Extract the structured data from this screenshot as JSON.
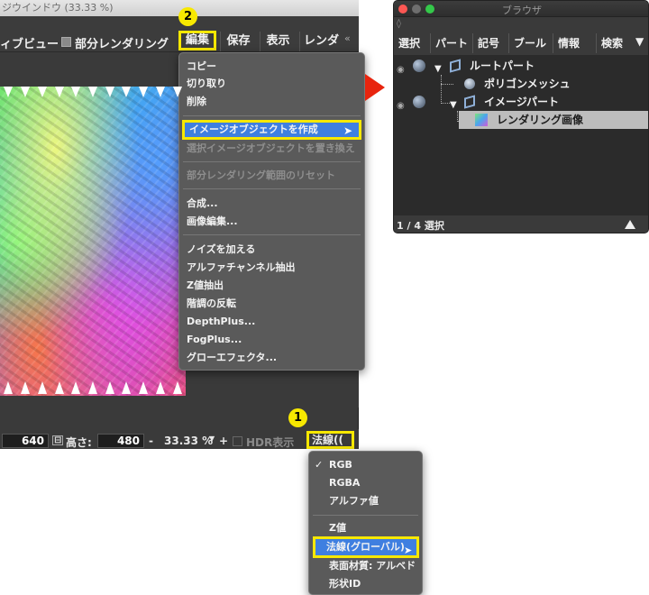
{
  "render_window": {
    "title": "ジウインドウ (33.33 %)",
    "toolbar": {
      "preview_label": "ィブビュー",
      "partial_render_label": "部分レンダリング",
      "tabs": [
        "編集",
        "保存",
        "表示",
        "レンダ"
      ],
      "overflow_icon": "double-chevron-icon"
    },
    "status": {
      "width_value": "640",
      "height_label": "高さ:",
      "height_value": "480",
      "minus_label": "-",
      "zoom_value": "33.33 %",
      "plus_label": "+",
      "hdr_label": "HDR表示",
      "output_value": "法線(("
    }
  },
  "edit_menu": {
    "items": [
      {
        "label": "コピー",
        "enabled": true
      },
      {
        "label": "切り取り",
        "enabled": true
      },
      {
        "label": "削除",
        "enabled": true
      },
      {
        "label": "イメージオブジェクトを作成",
        "enabled": true,
        "highlighted": true
      },
      {
        "label": "選択イメージオブジェクトを置き換え",
        "enabled": false
      },
      {
        "label": "部分レンダリング範囲のリセット",
        "enabled": false
      },
      {
        "label": "合成...",
        "enabled": true
      },
      {
        "label": "画像編集...",
        "enabled": true
      },
      {
        "label": "ノイズを加える",
        "enabled": true
      },
      {
        "label": "アルファチャンネル抽出",
        "enabled": true
      },
      {
        "label": "Z値抽出",
        "enabled": true
      },
      {
        "label": "階調の反転",
        "enabled": true
      },
      {
        "label": "DepthPlus...",
        "enabled": true
      },
      {
        "label": "FogPlus...",
        "enabled": true
      },
      {
        "label": "グローエフェクタ...",
        "enabled": true
      }
    ]
  },
  "output_menu": {
    "items": [
      {
        "label": "RGB",
        "checked": true
      },
      {
        "label": "RGBA",
        "checked": false
      },
      {
        "label": "アルファ値",
        "checked": false
      },
      {
        "label": "Z値",
        "checked": false
      },
      {
        "label": "法線(グローバル)",
        "checked": false,
        "highlighted": true
      },
      {
        "label": "表面材質: アルベド",
        "checked": false
      },
      {
        "label": "形状ID",
        "checked": false
      }
    ],
    "check_mark": "✓"
  },
  "badges": {
    "first": "1",
    "second": "2"
  },
  "browser": {
    "title": "ブラウザ",
    "tabs": [
      "選択",
      "パート",
      "記号",
      "ブール",
      "情報",
      "検索"
    ],
    "tree": [
      {
        "label": "ルートパート",
        "icon": "part-icon"
      },
      {
        "label": "ポリゴンメッシュ",
        "icon": "mesh-icon"
      },
      {
        "label": "イメージパート",
        "icon": "part-icon"
      },
      {
        "label": "レンダリング画像",
        "icon": "image-icon",
        "selected": true
      }
    ],
    "status": "1 / 4 選択"
  },
  "colors": {
    "highlight_border": "#f7e800",
    "selection_blue": "#3f7fe0",
    "arrow_red": "#e8240e"
  }
}
